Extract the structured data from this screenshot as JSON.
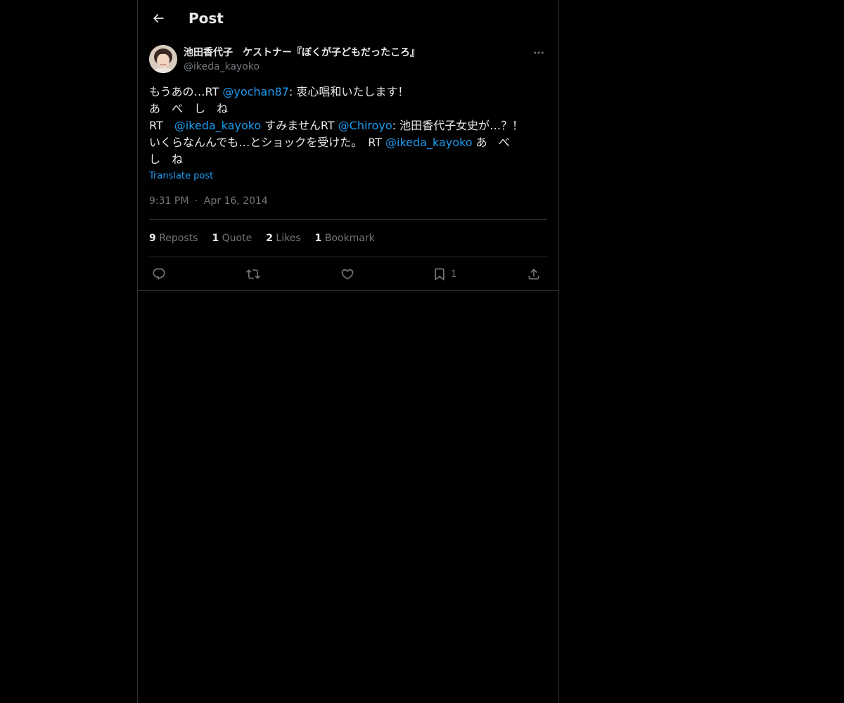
{
  "header": {
    "title": "Post"
  },
  "author": {
    "display_name": "池田香代子　ケストナー『ぼくが子どもだったころ』",
    "handle": "@ikeda_kayoko"
  },
  "post": {
    "segments": [
      {
        "text": "もうあの…RT ",
        "mention": false
      },
      {
        "text": "@yochan87",
        "mention": true
      },
      {
        "text": ": 衷心唱和いたします！\nあ　べ　し　ね\nRT　",
        "mention": false
      },
      {
        "text": "@ikeda_kayoko",
        "mention": true
      },
      {
        "text": " すみませんRT ",
        "mention": false
      },
      {
        "text": "@Chiroyo",
        "mention": true
      },
      {
        "text": ": 池田香代子女史が…？！\nいくらなんんでも…とショックを受けた。　RT ",
        "mention": false
      },
      {
        "text": "@ikeda_kayoko",
        "mention": true
      },
      {
        "text": " あ　べ\nし　ね",
        "mention": false
      }
    ],
    "translate_label": "Translate post",
    "time": "9:31 PM",
    "separator": "·",
    "date": "Apr 16, 2014"
  },
  "stats": [
    {
      "count": "9",
      "label": "Reposts"
    },
    {
      "count": "1",
      "label": "Quote"
    },
    {
      "count": "2",
      "label": "Likes"
    },
    {
      "count": "1",
      "label": "Bookmark"
    }
  ],
  "actions": {
    "bookmark_count": "1"
  },
  "colors": {
    "background": "#000000",
    "text": "#e7e9ea",
    "muted": "#71767b",
    "accent": "#1d9bf0",
    "border": "#2f3336"
  },
  "icons": {
    "back": "arrow-left-icon",
    "more": "more-horizontal-icon",
    "reply": "reply-icon",
    "repost": "repost-icon",
    "like": "heart-icon",
    "bookmark": "bookmark-icon",
    "share": "share-icon"
  }
}
